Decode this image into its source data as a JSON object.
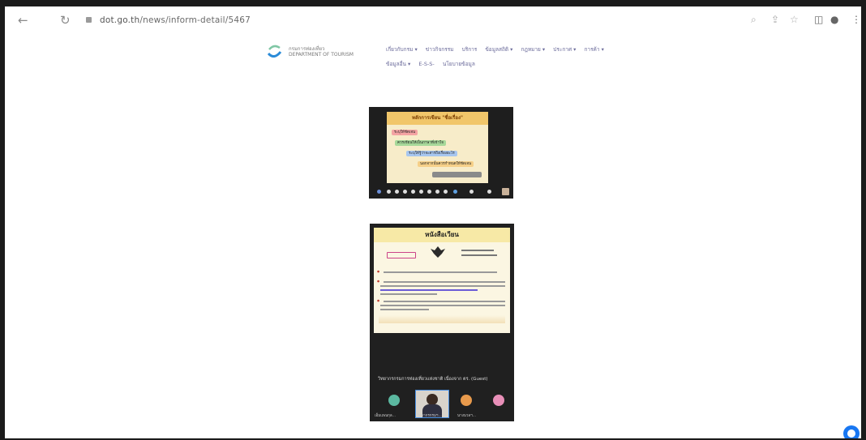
{
  "browser": {
    "url_domain": "dot.go.th",
    "url_path": "/news/inform-detail/5467"
  },
  "site": {
    "logo_text_line1": "กรมการท่องเที่ยว",
    "logo_text_line2": "DEPARTMENT OF TOURISM",
    "menu_row1": [
      "เกี่ยวกับกรม ▾",
      "ข่าวกิจกรรม",
      "บริการ",
      "ข้อมูลสถิติ ▾",
      "กฎหมาย ▾",
      "ประกาศ ▾",
      "การค้า ▾"
    ],
    "menu_row2": [
      "ข้อมูลอื่น ▾",
      "E-S-S-",
      "นโยบายข้อมูล"
    ]
  },
  "shot1": {
    "title": "หลักการเขียน \"ชื่อเรื่อง\"",
    "pills": [
      "ระบุให้ชัดเจน",
      "ควรเขียนให้เป็นภาษาที่เข้าใจ",
      "ระบุให้รู้ว่าจะสารถึงเรื่องอะไร",
      "นอกจากนั้นควรกำหนดให้ชัดเจน"
    ]
  },
  "shot2": {
    "title": "หนังสือเวียน",
    "meeting_name": "วิทยากรกรมการท่องเที่ยวแห่งชาติ เนื่องจาก ตร. (Guest)",
    "participants": [
      "เอ็มแพนกุล...",
      "วิทยากรกรมฯ...",
      "นางนวลฯ...",
      ""
    ]
  }
}
